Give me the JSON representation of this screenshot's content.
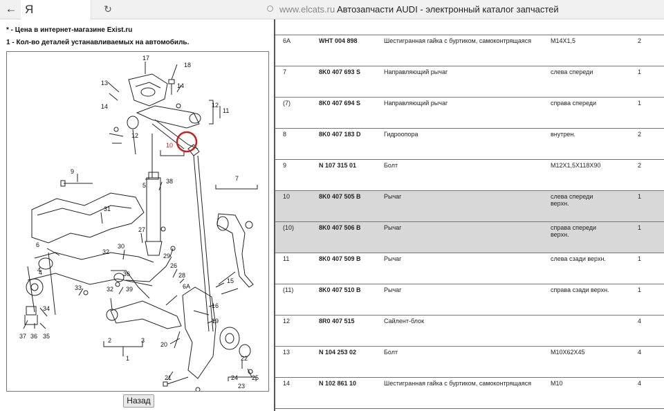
{
  "browser": {
    "back_icon": "arrow-left-icon",
    "brand": "Я",
    "reload_icon": "reload-icon",
    "url": "www.elcats.ru",
    "page_title": "Автозапчасти AUDI - электронный каталог запчастей"
  },
  "notes": {
    "note1": "* - Цена в интернет-магазине Exist.ru",
    "note2": "1 - Кол-во деталей устанавливаемых на автомобиль."
  },
  "diagram": {
    "callouts": [
      "17",
      "18",
      "14",
      "13",
      "12",
      "11",
      "14",
      "12",
      "10",
      "9",
      "5",
      "38",
      "7",
      "6",
      "31",
      "27",
      "4",
      "30",
      "32",
      "29",
      "26",
      "28",
      "15",
      "4",
      "33",
      "32",
      "36",
      "39",
      "6A",
      "16",
      "34",
      "19",
      "3",
      "2",
      "20",
      "37",
      "36",
      "35",
      "1",
      "22",
      "21",
      "24",
      "25",
      "23"
    ],
    "highlighted_label": "10"
  },
  "actions": {
    "back_label": "Назад"
  },
  "parts": [
    {
      "num": "6A",
      "part": "WHT 004 898",
      "name": "Шестигранная гайка с буртиком, самоконтрящаяся",
      "note": "M14X1,5",
      "qty": "2",
      "highlight": false
    },
    {
      "num": "7",
      "part": "8K0 407 693 S",
      "name": "Направляющий рычаг",
      "note": "слева спереди",
      "qty": "1",
      "highlight": false
    },
    {
      "num": "(7)",
      "part": "8K0 407 694 S",
      "name": "Направляющий рычаг",
      "note": "справа спереди",
      "qty": "1",
      "highlight": false
    },
    {
      "num": "8",
      "part": "8K0 407 183 D",
      "name": "Гидроопора",
      "note": "внутрен.",
      "qty": "2",
      "highlight": false
    },
    {
      "num": "9",
      "part": "N 107 315 01",
      "name": "Болт",
      "note": "M12X1,5X118X90",
      "qty": "2",
      "highlight": false
    },
    {
      "num": "10",
      "part": "8K0 407 505 B",
      "name": "Рычаг",
      "note": "слева спереди верхн.",
      "qty": "1",
      "highlight": true
    },
    {
      "num": "(10)",
      "part": "8K0 407 506 B",
      "name": "Рычаг",
      "note": "справа спереди верхн.",
      "qty": "1",
      "highlight": true
    },
    {
      "num": "11",
      "part": "8K0 407 509 B",
      "name": "Рычаг",
      "note": "слева сзади верхн.",
      "qty": "1",
      "highlight": false
    },
    {
      "num": "(11)",
      "part": "8K0 407 510 B",
      "name": "Рычаг",
      "note": "справа сзади верхн.",
      "qty": "1",
      "highlight": false
    },
    {
      "num": "12",
      "part": "8R0 407 515",
      "name": "Сайлент-блок",
      "note": "",
      "qty": "4",
      "highlight": false
    },
    {
      "num": "13",
      "part": "N 104 253 02",
      "name": "Болт",
      "note": "M10X62X45",
      "qty": "4",
      "highlight": false
    },
    {
      "num": "14",
      "part": "N 102 861 10",
      "name": "Шестигранная гайка с буртиком, самоконтрящаяся",
      "note": "M10",
      "qty": "4",
      "highlight": false
    }
  ]
}
